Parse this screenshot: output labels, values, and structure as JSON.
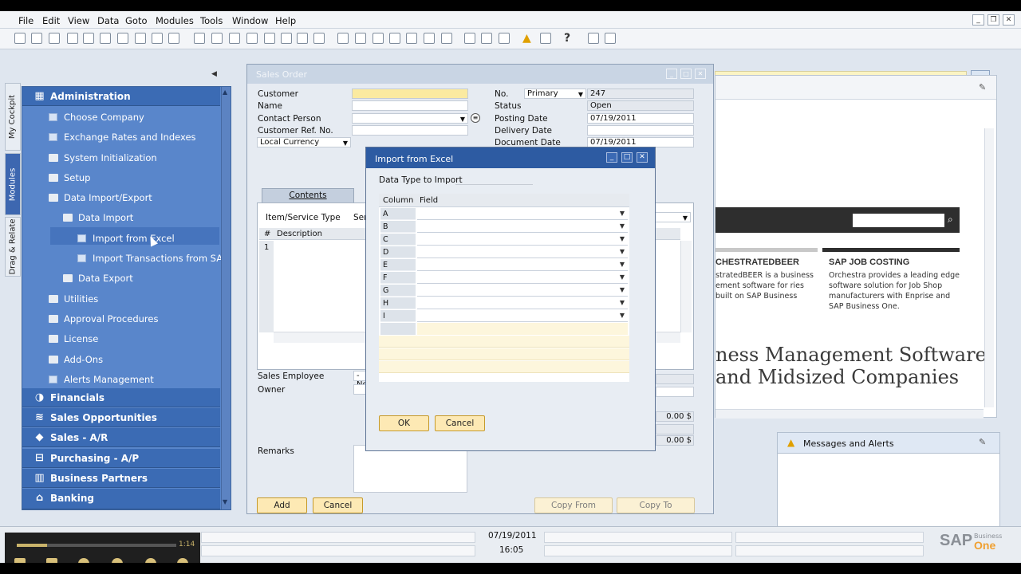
{
  "menubar": {
    "items": [
      "File",
      "Edit",
      "View",
      "Data",
      "Goto",
      "Modules",
      "Tools",
      "Window",
      "Help"
    ]
  },
  "left_tabs": {
    "cockpit": "My Cockpit",
    "modules": "Modules",
    "drag": "Drag & Relate"
  },
  "nav": {
    "administration": "Administration",
    "items": [
      "Choose Company",
      "Exchange Rates and Indexes",
      "System Initialization",
      "Setup",
      "Data Import/Export",
      "Data Import",
      "Import from Excel",
      "Import Transactions from SAP",
      "Data Export",
      "Utilities",
      "Approval Procedures",
      "License",
      "Add-Ons",
      "Alerts Management"
    ],
    "modules": [
      "Financials",
      "Sales Opportunities",
      "Sales - A/R",
      "Purchasing - A/P",
      "Business Partners",
      "Banking"
    ]
  },
  "sales_order": {
    "title": "Sales Order",
    "labels": {
      "customer": "Customer",
      "name": "Name",
      "contact_person": "Contact Person",
      "customer_ref": "Customer Ref. No.",
      "local_currency": "Local Currency",
      "no": "No.",
      "status": "Status",
      "posting_date": "Posting Date",
      "delivery_date": "Delivery Date",
      "document_date": "Document Date"
    },
    "values": {
      "series": "Primary",
      "no": "247",
      "status": "Open",
      "posting_date": "07/19/2011",
      "document_date": "07/19/2011"
    },
    "contents_tab": "Contents",
    "item_service_type": "Item/Service Type",
    "item_service_value": "Serv",
    "grid_headers": {
      "num": "#",
      "description": "Description"
    },
    "row1": "1",
    "sales_employee": "Sales Employee",
    "sales_employee_value": "-No",
    "owner": "Owner",
    "remarks": "Remarks",
    "amount1": "0.00 $",
    "amount2": "0.00 $",
    "buttons": {
      "add": "Add",
      "cancel": "Cancel",
      "copy_from": "Copy From",
      "copy_to": "Copy To"
    }
  },
  "import_dialog": {
    "title": "Import from Excel",
    "data_type_label": "Data Type to Import",
    "col_header": "Column",
    "field_header": "Field",
    "rows": [
      "A",
      "B",
      "C",
      "D",
      "E",
      "F",
      "G",
      "H",
      "I"
    ],
    "ok": "OK",
    "cancel": "Cancel"
  },
  "right_pane": {
    "ad1_title": "CHESTRATEDBEER",
    "ad1_text": "stratedBEER is a business ement software for ries built on SAP Business",
    "ad2_title": "SAP JOB COSTING",
    "ad2_text": "Orchestra provides a leading edge software solution for Job Shop manufacturers with Enprise and SAP Business One.",
    "headline1": "ness Management Software",
    "headline2": "and Midsized Companies"
  },
  "messages": {
    "title": "Messages and Alerts"
  },
  "statusbar": {
    "date": "07/19/2011",
    "time": "16:05",
    "logo": "SAP",
    "logo_sub": "Business",
    "logo_one": "One"
  },
  "video": {
    "time": "1:14"
  }
}
